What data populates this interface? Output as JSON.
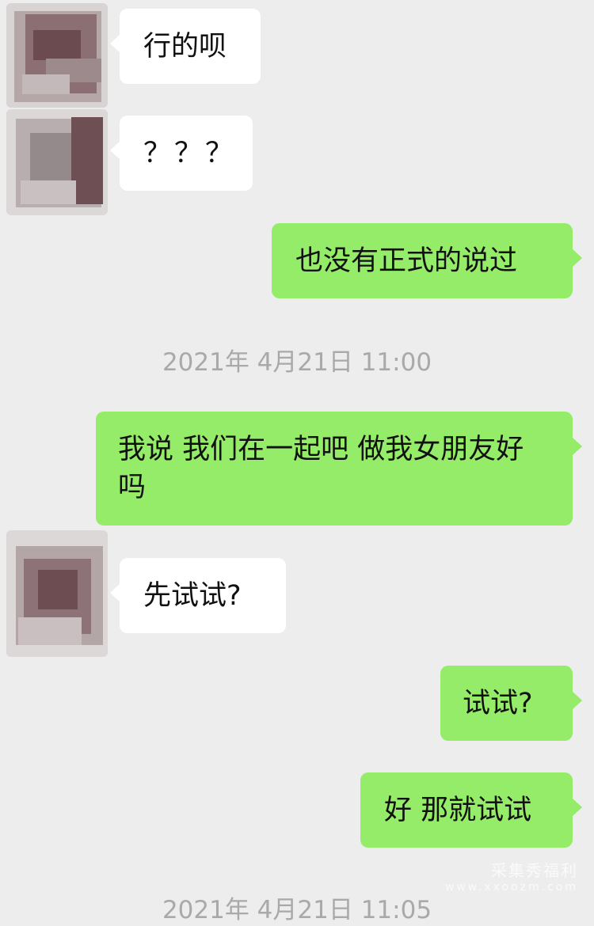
{
  "chat": {
    "messages": [
      {
        "side": "in",
        "text": "行的呗"
      },
      {
        "side": "in",
        "text": "？？？"
      },
      {
        "side": "out",
        "text": "也没有正式的说过"
      },
      {
        "type": "time",
        "text": "2021年 4月21日 11:00"
      },
      {
        "side": "out",
        "text": "我说 我们在一起吧 做我女朋友好吗"
      },
      {
        "side": "in",
        "text": "先试试?"
      },
      {
        "side": "out",
        "text": "试试?"
      },
      {
        "side": "out",
        "text": "好 那就试试"
      },
      {
        "type": "time",
        "text": "2021年 4月21日 11:05"
      }
    ]
  },
  "watermark": {
    "line1": "采集秀福利",
    "line2": "www.xxoozm.com"
  }
}
